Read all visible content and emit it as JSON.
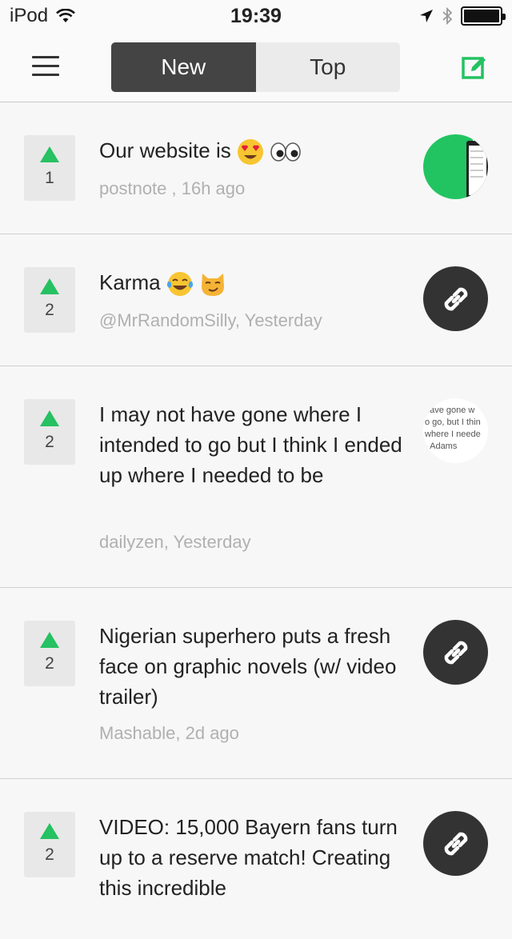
{
  "status_bar": {
    "carrier": "iPod",
    "time": "19:39"
  },
  "nav": {
    "tabs": [
      {
        "label": "New",
        "active": true
      },
      {
        "label": "Top",
        "active": false
      }
    ],
    "accent_color": "#25c162",
    "dark_color": "#444444"
  },
  "feed": [
    {
      "votes": "1",
      "title": "Our website is",
      "meta": "postnote , 16h ago",
      "thumb": "image"
    },
    {
      "votes": "2",
      "title": "Karma",
      "meta": "@MrRandomSilly, Yesterday",
      "thumb": "link-icon"
    },
    {
      "votes": "2",
      "title": "I may not have gone where I intended to go but I think I ended up where I needed to be",
      "meta": "dailyzen, Yesterday",
      "thumb": "quote-image",
      "thumb_text": [
        "have gone w",
        "o go, but I thin",
        "where I neede",
        "- Adams"
      ]
    },
    {
      "votes": "2",
      "title": "Nigerian superhero puts a fresh face on graphic novels (w/ video trailer)",
      "meta": "Mashable, 2d ago",
      "thumb": "link-icon"
    },
    {
      "votes": "2",
      "title": "VIDEO: 15,000 Bayern fans turn up to a reserve match! Creating this incredible",
      "meta": "",
      "thumb": "link-icon"
    }
  ]
}
